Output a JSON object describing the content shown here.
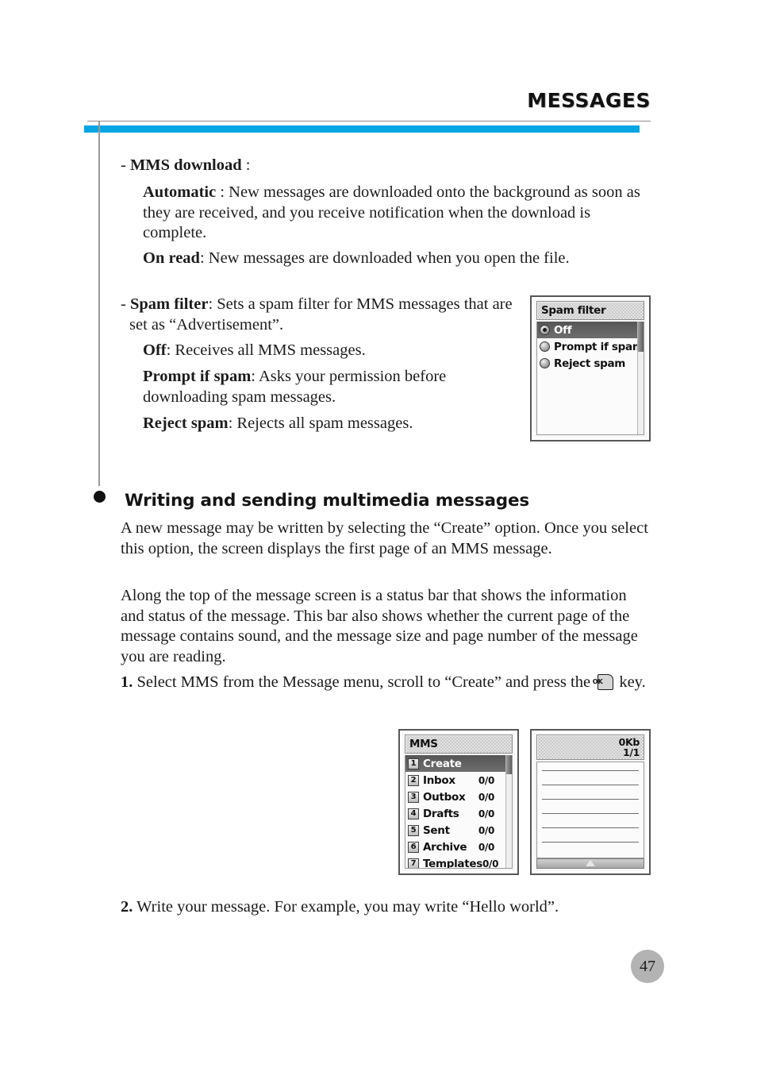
{
  "header": {
    "title": "MESSAGES",
    "accent_color": "#00a5e3",
    "rule_color": "#8d8d8d"
  },
  "body": {
    "mms_download": {
      "bullet": "-",
      "term": "MMS download",
      "suffix": " :"
    },
    "automatic": {
      "term": "Automatic",
      "text": " : New messages are downloaded onto the background as soon as they are received, and you receive notification when the download is complete."
    },
    "on_read": {
      "term": "On read",
      "text": ": New messages are downloaded when you open the file."
    },
    "spam_filter": {
      "bullet": "-",
      "term": "Spam filter",
      "text": ": Sets a spam filter for MMS messages that are set as “Advertisement”."
    },
    "off": {
      "term": "Off",
      "text": ": Receives all MMS messages."
    },
    "prompt_if_spam": {
      "term": "Prompt if spam",
      "text": ": Asks your permission before downloading spam messages."
    },
    "reject_spam": {
      "term": "Reject spam",
      "text": ": Rejects all spam messages."
    },
    "section_heading": "Writing and sending multimedia messages",
    "para1": "A new message may be written by selecting the “Create” option. Once you select this option, the screen displays the first page of an MMS message.",
    "para2": "Along the top of the message screen is a status bar that shows the information and status of the message. This bar also shows whether the current page of the message contains sound, and the message size and page number of the message you are reading.",
    "step1": {
      "number": "1.",
      "text_before": "Select MMS from the Message menu, scroll to “Create” and press the",
      "key_label": "OK",
      "text_after": "key."
    },
    "step2": {
      "number": "2.",
      "text": "Write your message. For example, you may write “Hello world”."
    }
  },
  "spam_filter_screen": {
    "title": "Spam filter",
    "options": [
      {
        "label": "Off",
        "selected": true
      },
      {
        "label": "Prompt if spam",
        "selected": false
      },
      {
        "label": "Reject spam",
        "selected": false
      }
    ]
  },
  "mms_menu_screen": {
    "title": "MMS",
    "items": [
      {
        "num": "1",
        "label": "Create",
        "count": "",
        "highlighted": true
      },
      {
        "num": "2",
        "label": "Inbox",
        "count": "0/0",
        "highlighted": false
      },
      {
        "num": "3",
        "label": "Outbox",
        "count": "0/0",
        "highlighted": false
      },
      {
        "num": "4",
        "label": "Drafts",
        "count": "0/0",
        "highlighted": false
      },
      {
        "num": "5",
        "label": "Sent",
        "count": "0/0",
        "highlighted": false
      },
      {
        "num": "6",
        "label": "Archive",
        "count": "0/0",
        "highlighted": false
      },
      {
        "num": "7",
        "label": "Templates",
        "count": "0/0",
        "highlighted": false
      }
    ]
  },
  "compose_screen": {
    "size": "0Kb",
    "page": "1/1"
  },
  "page_number": "47"
}
